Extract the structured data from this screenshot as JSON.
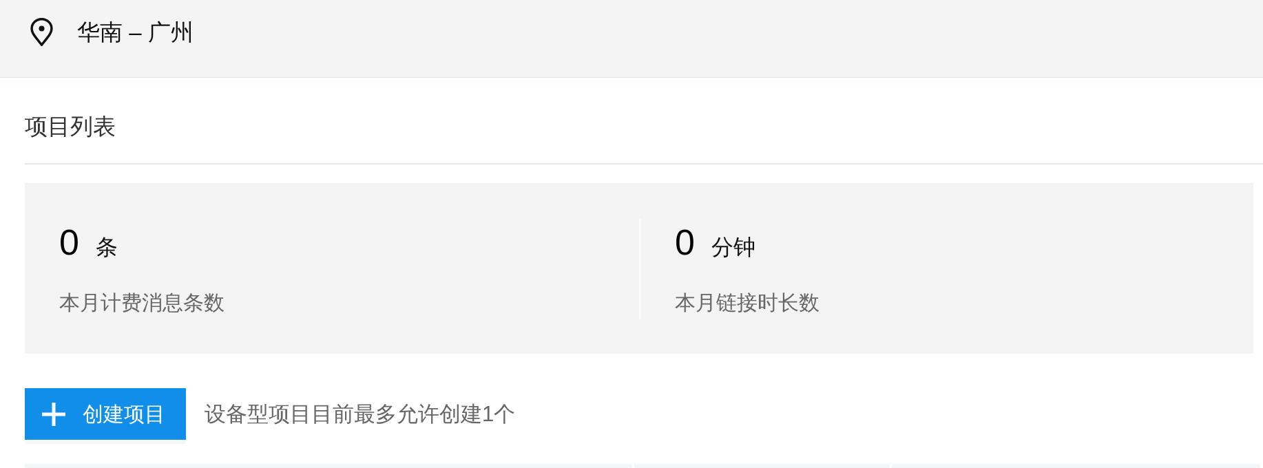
{
  "location": {
    "text": "华南 – 广州"
  },
  "section": {
    "title": "项目列表"
  },
  "stats": [
    {
      "value": "0",
      "unit": "条",
      "label": "本月计费消息条数"
    },
    {
      "value": "0",
      "unit": "分钟",
      "label": "本月链接时长数"
    }
  ],
  "create_button": {
    "label": "创建项目"
  },
  "hint": "设备型项目目前最多允许创建1个"
}
